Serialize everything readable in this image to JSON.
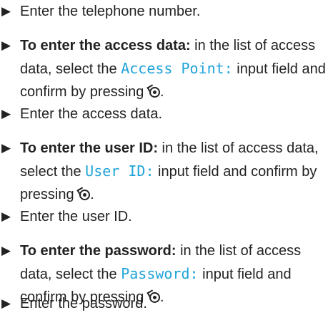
{
  "bullet_glyph": "▶",
  "steps": [
    {
      "text": "Enter the telephone number."
    },
    {
      "lead": "To enter the access data:",
      "before": " in the list of access data, select the ",
      "ui_term": "Access Point:",
      "after": " input field and confirm by pressing ",
      "end": ".",
      "icon": "controller-press-icon"
    },
    {
      "text": "Enter the access data."
    },
    {
      "lead": "To enter the user ID:",
      "before": " in the list of access data, select the ",
      "ui_term": "User ID:",
      "after": " input field and confirm by pressing ",
      "end": ".",
      "icon": "controller-press-icon"
    },
    {
      "text": "Enter the user ID."
    },
    {
      "lead": "To enter the password:",
      "before": " in the list of access data, select the ",
      "ui_term": "Password:",
      "after": " input field and confirm by pressing ",
      "end": ".",
      "icon": "controller-press-icon"
    },
    {
      "text": "Enter the password."
    }
  ],
  "colors": {
    "text": "#222222",
    "ui_term": "#1ea3d9"
  }
}
